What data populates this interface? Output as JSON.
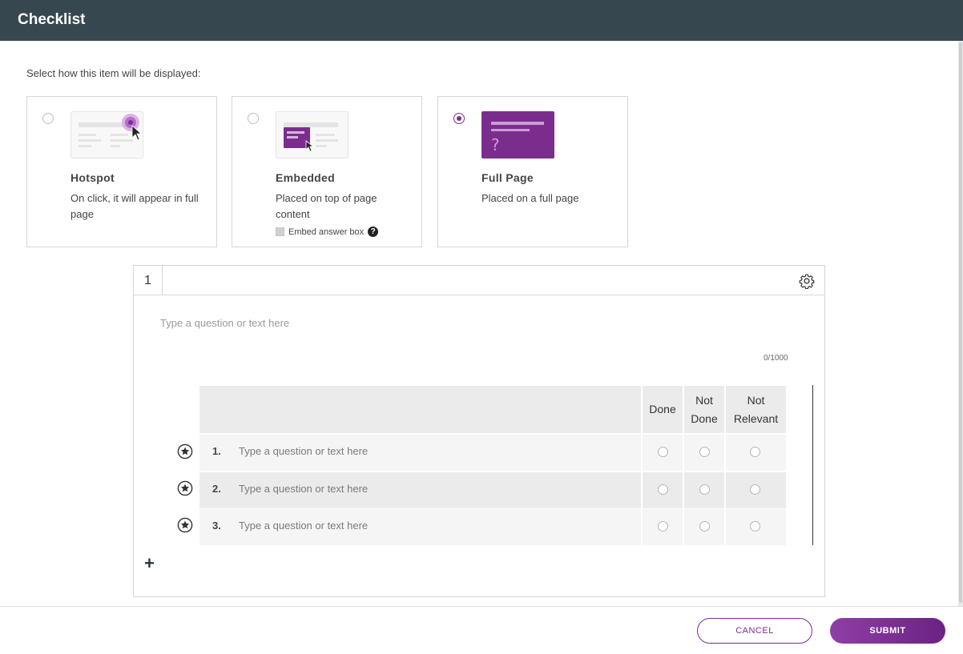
{
  "window": {
    "title": "Checklist"
  },
  "display_prompt": "Select how this item will be displayed:",
  "display_options": [
    {
      "title": "Hotspot",
      "description": "On click, it will appear in full page",
      "selected": false
    },
    {
      "title": "Embedded",
      "description": "Placed on top of page content",
      "selected": false,
      "extra_option": "Embed answer box",
      "extra_help": "?"
    },
    {
      "title": "Full Page",
      "description": "Placed on a full page",
      "selected": true,
      "preview_glyph": "?"
    }
  ],
  "question": {
    "number": "1",
    "placeholder": "Type a question or text here",
    "char_counter": "0/1000"
  },
  "checklist": {
    "columns": [
      "Done",
      "Not Done",
      "Not Relevant"
    ],
    "items": [
      {
        "number": "1.",
        "placeholder": "Type a question or text here"
      },
      {
        "number": "2.",
        "placeholder": "Type a question or text here"
      },
      {
        "number": "3.",
        "placeholder": "Type a question or text here"
      }
    ],
    "add_label": "+"
  },
  "footer": {
    "cancel_label": "CANCEL",
    "submit_label": "SUBMIT"
  },
  "colors": {
    "accent": "#7b2d8e",
    "titlebar": "#37474f"
  }
}
